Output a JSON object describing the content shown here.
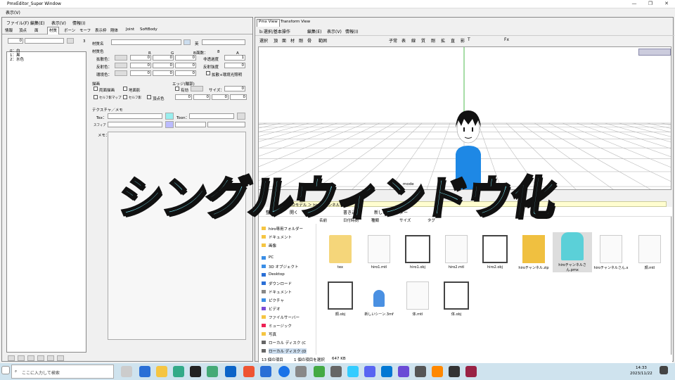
{
  "window": {
    "title": "PmxEditor_Super Window",
    "menu": [
      "表示(V)"
    ]
  },
  "left": {
    "menu": [
      "ファイル(F)",
      "編集(E)",
      "表示(V)",
      "情報(I)"
    ],
    "tabs": [
      "情報",
      "頂点",
      "面",
      "材質",
      "ボーン",
      "モーフ",
      "表示枠",
      "剛体",
      "Joint",
      "SoftBody"
    ],
    "active_tab": "材質",
    "index_value": "0",
    "count_value": "3",
    "list_items": [
      "0：白",
      "1：黒",
      "2：水色"
    ],
    "material": {
      "name_label": "材質名",
      "en_label": "英",
      "face_count_label": "面数：",
      "face_count": "8",
      "color_label": "材質色",
      "r": "R",
      "g": "G",
      "b": "B",
      "a": "A",
      "diffuse": "拡散色：",
      "specular": "反射色：",
      "ambient": "環境色：",
      "diffuse_vals": [
        "0",
        "0",
        "0"
      ],
      "specular_vals": [
        "0",
        "0",
        "0"
      ],
      "ambient_vals": [
        "0",
        "0",
        "0"
      ],
      "alpha_label": "非透過度",
      "alpha_val": "1",
      "spec_label": "反射強度",
      "spec_val": "0",
      "ambient_mode": "拡散+環境光照明"
    },
    "draw": {
      "label": "描画",
      "double_side": "両面描画",
      "ground_shadow": "地面影",
      "self_map": "セルフ影マップ",
      "self_shadow": "セルフ影",
      "vertex_color": "頂点色",
      "edge_label": "エッジ(輪郭)",
      "enabled": "有効",
      "size_label": "サイズ：",
      "size_val": "0",
      "edge_vals": [
        "0",
        "0",
        "0",
        "0"
      ]
    },
    "texture": {
      "label": "テクスチャ／メモ",
      "tex": "Tex：",
      "toon": "Toon：",
      "sphere": "スフィア"
    },
    "memo_label": "メモ："
  },
  "right": {
    "tabs": [
      "Pmx View",
      "Transform View"
    ],
    "menu": [
      "b:選択/基本操作",
      "編集(E)",
      "表示(V)",
      "情報(I)"
    ],
    "toolbar": [
      "選択",
      "頂",
      "面",
      "材",
      "剛",
      "骨",
      "範囲",
      "子常",
      "表",
      "線",
      "質",
      "剛",
      "拡",
      "直",
      "影",
      "T",
      "Fx"
    ],
    "mode_label": "mode",
    "address": "3Dモデル ＞ hiroチャンネル",
    "explorer_tools": [
      "整理",
      "開く",
      "新しいフォルダー",
      "書き込む"
    ],
    "columns": [
      "名前",
      "日付時刻",
      "種類",
      "サイズ",
      "タグ"
    ],
    "nav": [
      "hiro専用フォルダー",
      "ドキュメント",
      "画像",
      "PC",
      "3D オブジェクト",
      "Desktop",
      "ダウンロード",
      "ドキュメント",
      "ピクチャ",
      "ビデオ",
      "ファイルサーバー",
      "ミュージック",
      "写真",
      "ローカル ディスク (C",
      "ローカル ディスク (D"
    ],
    "files": [
      "tex",
      "hiro1.mtl",
      "hiro1.obj",
      "hiro2.mtl",
      "hiro2.obj",
      "hiroチャンネル.zip",
      "hiroチャンネルさん.pmx",
      "hiroチャンネルさん.x",
      "顔.mtl",
      "顔.obj",
      "新しいシーン.3mf",
      "体.mtl",
      "体.obj"
    ],
    "status": [
      "13 個の項目",
      "1 個の項目を選択",
      "647 KB"
    ]
  },
  "taskbar": {
    "search_placeholder": "ここに入力して検索",
    "time": "14:33",
    "date": "2023/11/22"
  },
  "overlay": {
    "text": "シングルウィンドウ化",
    "color": "#7df0ff"
  }
}
